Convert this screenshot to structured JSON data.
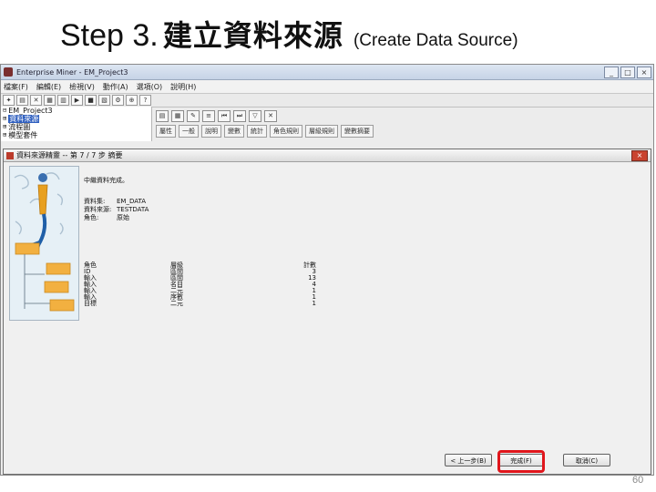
{
  "slide": {
    "title_step": "Step 3.",
    "title_cjk": "建立資料來源",
    "title_sub": "(Create Data Source)",
    "page_number": "60"
  },
  "app": {
    "window_title": "Enterprise Miner - EM_Project3",
    "window_buttons": [
      "_",
      "□",
      "×"
    ],
    "menu": [
      "檔案(F)",
      "編輯(E)",
      "檢視(V)",
      "動作(A)",
      "選項(O)",
      "說明(H)"
    ],
    "tree": [
      {
        "icon": "⊟",
        "label": "EM_Project3",
        "selected": false
      },
      {
        "icon": "⊞",
        "label": "資料來源",
        "selected": true
      },
      {
        "icon": "⊞",
        "label": "流程圖",
        "selected": false
      },
      {
        "icon": "⊞",
        "label": "模型套件",
        "selected": false
      }
    ],
    "property_tabs": [
      "屬性",
      "一般",
      "說明",
      "變數",
      "統計",
      "角色規則",
      "層級規則",
      "變數摘要"
    ]
  },
  "dialog": {
    "title": "資料來源精靈 -- 第 7 / 7 步 摘要",
    "close_label": "×",
    "summary_heading": "中繼資料完成。",
    "fields": [
      {
        "label": "資料集:",
        "value": "EM_DATA"
      },
      {
        "label": "資料來源:",
        "value": "TESTDATA"
      },
      {
        "label": "角色:",
        "value": "原始"
      }
    ],
    "table_header": {
      "role": "角色",
      "level": "層級",
      "count": "計數"
    },
    "table_rows": [
      {
        "role": "ID",
        "level": "區間",
        "count": "3"
      },
      {
        "role": "輸入",
        "level": "區間",
        "count": "13"
      },
      {
        "role": "輸入",
        "level": "名目",
        "count": "4"
      },
      {
        "role": "輸入",
        "level": "二元",
        "count": "1"
      },
      {
        "role": "輸入",
        "level": "序數",
        "count": "1"
      },
      {
        "role": "目標",
        "level": "二元",
        "count": "1"
      }
    ],
    "buttons": {
      "back": "< 上一步(B)",
      "finish": "完成(F)",
      "cancel": "取消(C)"
    }
  }
}
